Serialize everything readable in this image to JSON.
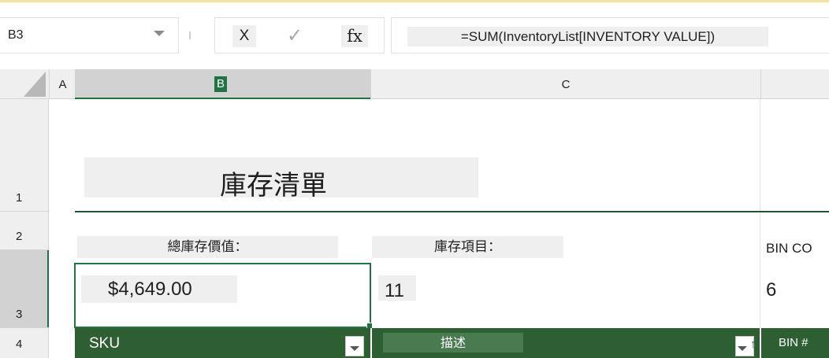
{
  "formula_bar": {
    "name_box": "B3",
    "cancel_label": "X",
    "enter_label": "✓",
    "function_label": "fx",
    "formula": "=SUM(InventoryList[INVENTORY VALUE])"
  },
  "columns": [
    "A",
    "B",
    "C"
  ],
  "rows": [
    "1",
    "2",
    "3",
    "4"
  ],
  "sheet": {
    "title": "庫存清單",
    "total_value_label": "總庫存價值：",
    "total_value": "$4,649.00",
    "inventory_items_label": "庫存項目：",
    "inventory_items": "11",
    "bin_count_label": "BIN CO",
    "bin_count": "6"
  },
  "table": {
    "headers": [
      "SKU",
      "描述",
      "BIN #"
    ]
  },
  "colors": {
    "accent": "#217346",
    "table_header": "#2d5f32"
  },
  "icons": {
    "dropdown": "chevron-down-icon",
    "filter": "filter-dropdown-icon",
    "sort": "sort-ascending-icon"
  }
}
